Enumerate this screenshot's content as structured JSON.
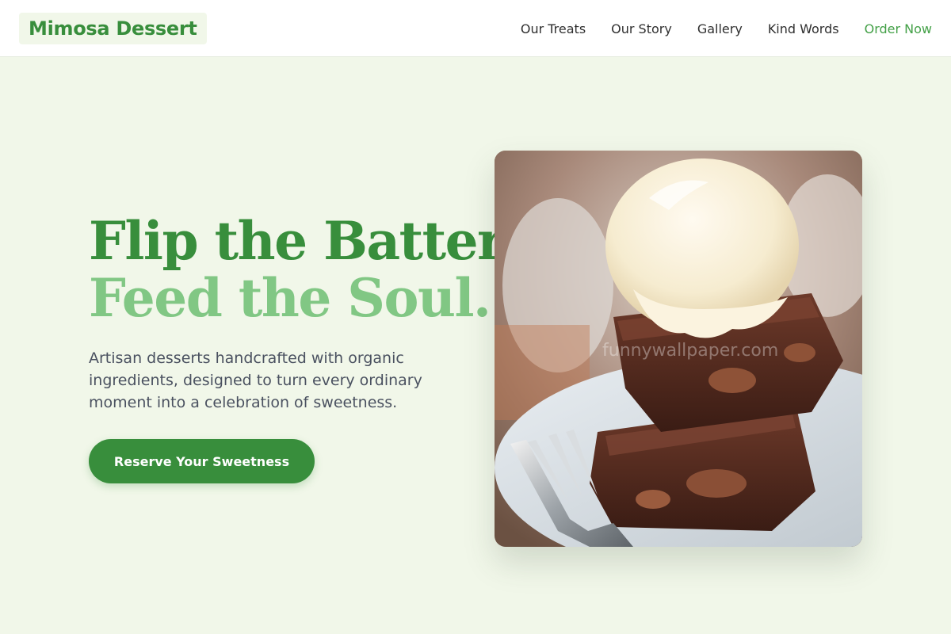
{
  "brand": {
    "name": "Mimosa Dessert",
    "primary": "#388e3c",
    "accent": "#81c784",
    "background": "#f1f7e9"
  },
  "nav": {
    "items": [
      "Our Treats",
      "Our Story",
      "Gallery",
      "Kind Words"
    ],
    "cta": "Order Now"
  },
  "hero": {
    "headline_line1": "Flip the Batter,",
    "headline_line2": "Feed the Soul.",
    "subtext": "Artisan desserts handcrafted with organic ingredients, designed to turn every ordinary moment into a celebration of sweetness.",
    "button_label": "Reserve Your Sweetness",
    "image": {
      "subject": "brownie-with-ice-cream-photo",
      "watermark": "funnywallpaper.com"
    }
  }
}
